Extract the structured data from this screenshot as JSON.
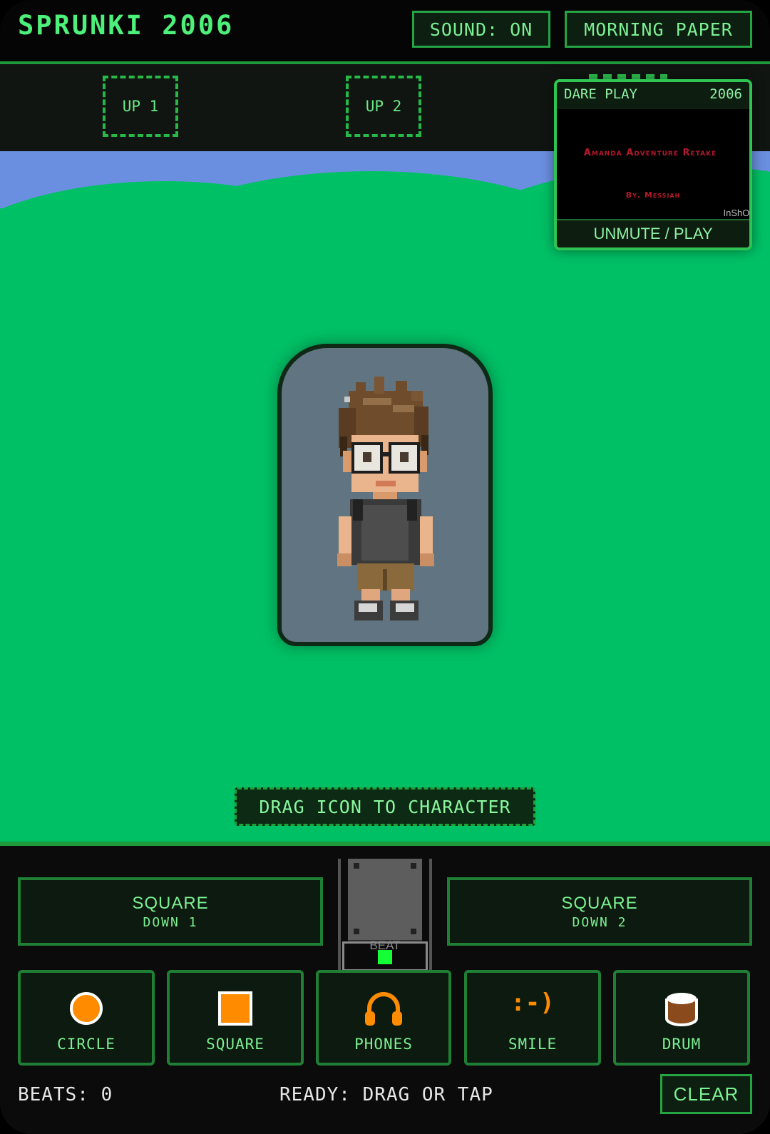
{
  "app": {
    "title": "SPRUNKI 2006"
  },
  "header": {
    "sound_button": "SOUND: ON",
    "paper_button": "MORNING PAPER"
  },
  "up_slots": [
    "UP 1",
    "UP 2"
  ],
  "stage": {
    "hint": "DRAG ICON TO CHARACTER"
  },
  "video": {
    "source": "DARE PLAY",
    "year": "2006",
    "title": "Amanda Adventure Retake",
    "byline": "By. Messiah",
    "watermark": "InShOt",
    "action": "UNMUTE / PLAY"
  },
  "down_slots": [
    {
      "label": "SQUARE",
      "sub": "DOWN 1"
    },
    {
      "label": "SQUARE",
      "sub": "DOWN 2"
    }
  ],
  "beat": {
    "label": "BEAT"
  },
  "tools": [
    {
      "label": "CIRCLE",
      "icon": "circle-icon"
    },
    {
      "label": "SQUARE",
      "icon": "square-icon"
    },
    {
      "label": "PHONES",
      "icon": "headphones-icon"
    },
    {
      "label": "SMILE",
      "icon": "smile-icon",
      "glyph": ":-)"
    },
    {
      "label": "DRUM",
      "icon": "drum-icon"
    }
  ],
  "footer": {
    "beats": "BEATS: 0",
    "status": "READY: DRAG OR TAP",
    "clear_button": "CLEAR"
  },
  "colors": {
    "accent": "#2fc352",
    "stage": "#00c065",
    "sky": "#6b8fe0",
    "icon_orange": "#ff8c00"
  }
}
